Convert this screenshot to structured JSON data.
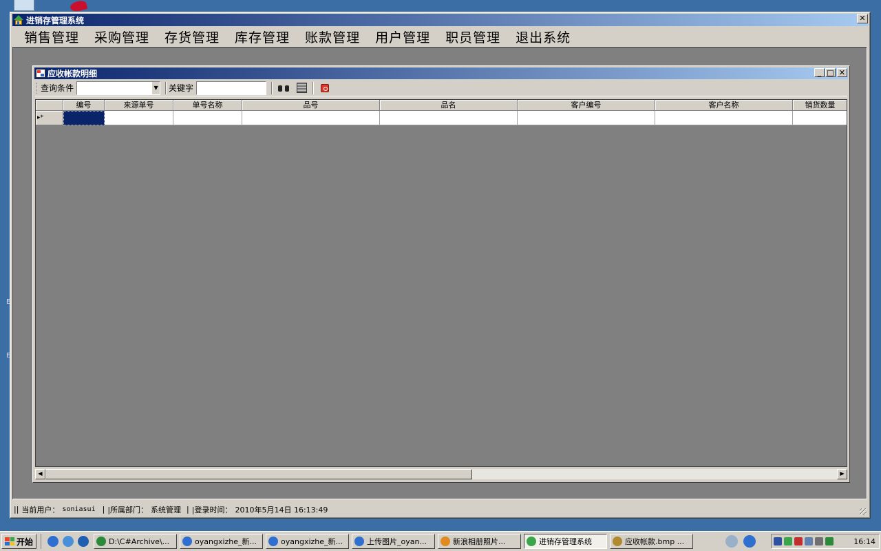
{
  "desktop": {
    "marks": [
      "E",
      "E"
    ]
  },
  "main_window": {
    "title": "进销存管理系统",
    "close_glyph": "✕",
    "menu": [
      "销售管理",
      "采购管理",
      "存货管理",
      "库存管理",
      "账款管理",
      "用户管理",
      "职员管理",
      "退出系统"
    ]
  },
  "child_window": {
    "title": "应收帐款明细",
    "min_glyph": "_",
    "max_glyph": "□",
    "close_glyph": "✕",
    "toolbar": {
      "condition_label": "查询条件",
      "condition_value": "",
      "keyword_label": "关键字",
      "keyword_value": ""
    },
    "grid": {
      "columns": [
        "编号",
        "来源单号",
        "单号名称",
        "品号",
        "品名",
        "客户编号",
        "客户名称",
        "销货数量"
      ],
      "new_row_marker": "▸*"
    }
  },
  "status": {
    "sep": "||",
    "user_label": "当前用户：",
    "user_value": "soniasui",
    "dept_label": "|所属部门：",
    "dept_value": "系统管理",
    "time_label": "|登录时间：",
    "time_value": "2010年5月14日 16:13:49"
  },
  "taskbar": {
    "start_label": "开始",
    "tasks": [
      {
        "label": "D:\\C#Archive\\...",
        "color": "#2a8a3a"
      },
      {
        "label": "oyangxizhe_新...",
        "color": "#2f6fd0"
      },
      {
        "label": "oyangxizhe_新...",
        "color": "#2f6fd0"
      },
      {
        "label": "上传图片_oyan...",
        "color": "#2f6fd0"
      },
      {
        "label": "新浪相册照片...",
        "color": "#e08a20"
      },
      {
        "label": "进销存管理系统",
        "color": "#3aa54a"
      },
      {
        "label": "应收帐款.bmp ...",
        "color": "#b08a30"
      }
    ],
    "clock": "16:14"
  }
}
